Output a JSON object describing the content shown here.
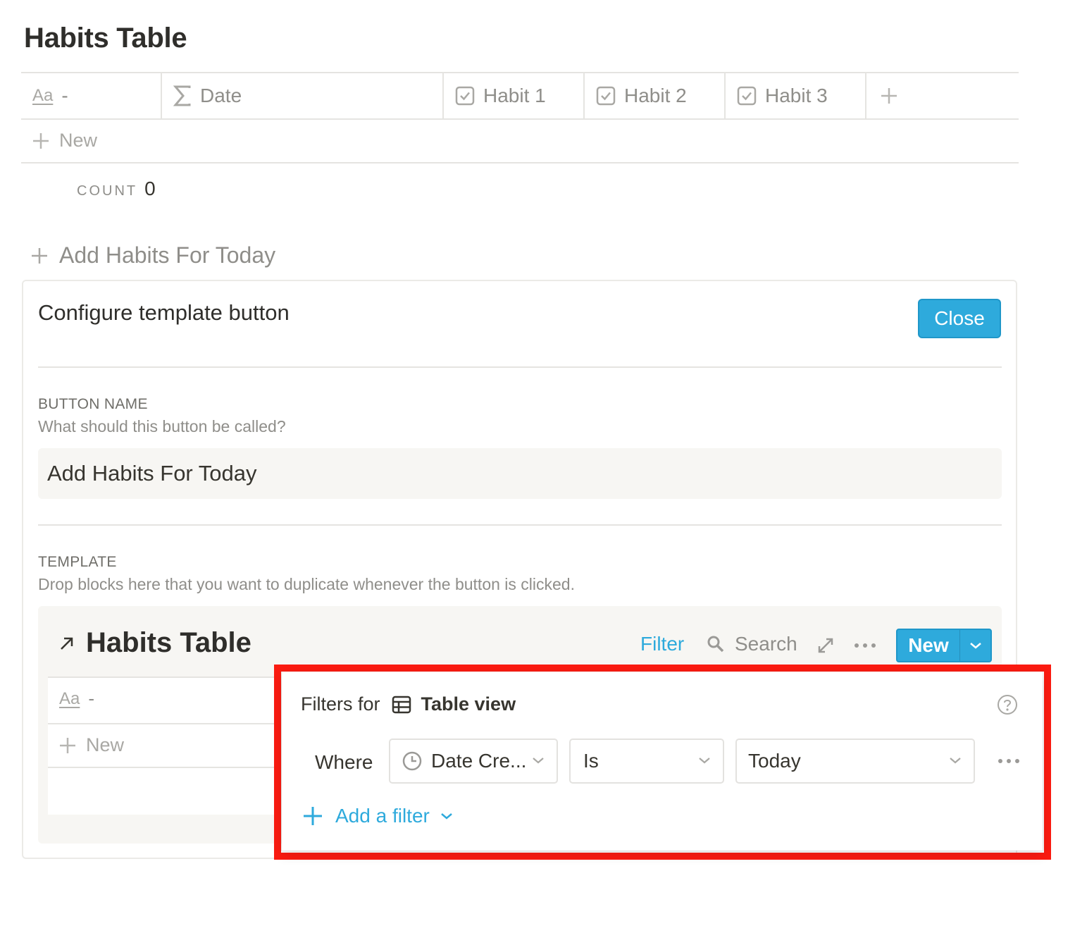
{
  "page": {
    "title": "Habits Table"
  },
  "table": {
    "columns": [
      {
        "icon": "text-property-icon",
        "icon_text": "Aa",
        "label": "-"
      },
      {
        "icon": "sigma-icon",
        "label": "Date"
      },
      {
        "icon": "checkbox-icon",
        "label": "Habit 1"
      },
      {
        "icon": "checkbox-icon",
        "label": "Habit 2"
      },
      {
        "icon": "checkbox-icon",
        "label": "Habit 3"
      }
    ],
    "add_column_icon": "plus-icon",
    "new_row_label": "New",
    "count_label": "COUNT",
    "count_value": "0"
  },
  "template_button": {
    "label": "Add Habits For Today"
  },
  "config": {
    "title": "Configure template button",
    "close_label": "Close",
    "button_name_label": "BUTTON NAME",
    "button_name_desc": "What should this button be called?",
    "button_name_value": "Add Habits For Today",
    "template_label": "TEMPLATE",
    "template_desc": "Drop blocks here that you want to duplicate whenever the button is clicked."
  },
  "inner_table": {
    "title": "Habits Table",
    "filter_label": "Filter",
    "search_label": "Search",
    "new_label": "New",
    "first_col_icon_text": "Aa",
    "first_col_label": "-",
    "new_row_label": "New"
  },
  "filter_popup": {
    "heading_prefix": "Filters for",
    "view_name": "Table view",
    "where_label": "Where",
    "property_value": "Date Cre...",
    "operator_value": "Is",
    "value_value": "Today",
    "add_filter_label": "Add a filter"
  },
  "colors": {
    "accent": "#2eaadc",
    "highlight": "#fb1b11",
    "text": "#37352f",
    "muted": "#9b9a97",
    "surface": "#f7f6f3"
  }
}
